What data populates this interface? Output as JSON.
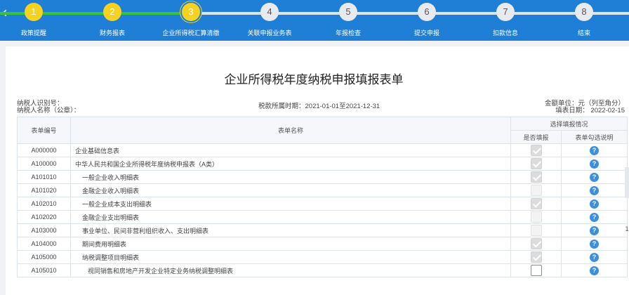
{
  "nav": {
    "back_glyph": "‹"
  },
  "steps": [
    {
      "num": "1",
      "label": "政策提醒",
      "state": "done"
    },
    {
      "num": "2",
      "label": "财务报表",
      "state": "done"
    },
    {
      "num": "3",
      "label": "企业所得税汇算清缴",
      "state": "current"
    },
    {
      "num": "4",
      "label": "关联申报业务表",
      "state": "todo"
    },
    {
      "num": "5",
      "label": "年报检查",
      "state": "todo"
    },
    {
      "num": "6",
      "label": "提交申报",
      "state": "todo"
    },
    {
      "num": "7",
      "label": "扣款信息",
      "state": "todo"
    },
    {
      "num": "8",
      "label": "结束",
      "state": "todo"
    }
  ],
  "page": {
    "title": "企业所得税年度纳税申报填报表单",
    "taxpayer_id_label": "纳税人识别号：",
    "taxpayer_name_label": "纳税人名称（公章）：",
    "tax_period": "税款所属时期：2021-01-01至2021-12-31",
    "amount_unit": "金额单位：元（列至角分）",
    "fill_date": "填表日期： 2022-02-15"
  },
  "side_number": "1",
  "table": {
    "headers": {
      "code": "表单编号",
      "name": "表单名称",
      "group": "选择填报情况",
      "fill": "是否填报",
      "explain": "表单勾选说明"
    },
    "rows": [
      {
        "code": "A000000",
        "name": "企业基础信息表",
        "level": 0,
        "check": "checked"
      },
      {
        "code": "A100000",
        "name": "中华人民共和国企业所得税年度纳税申报表（A类）",
        "level": 0,
        "check": "checked"
      },
      {
        "code": "A101010",
        "name": "一般企业收入明细表",
        "level": 1,
        "check": "checked"
      },
      {
        "code": "A101020",
        "name": "金融企业收入明细表",
        "level": 1,
        "check": "disabled"
      },
      {
        "code": "A102010",
        "name": "一般企业成本支出明细表",
        "level": 1,
        "check": "checked"
      },
      {
        "code": "A102020",
        "name": "金融企业支出明细表",
        "level": 1,
        "check": "disabled"
      },
      {
        "code": "A103000",
        "name": "事业单位、民间非营利组织收入、支出明细表",
        "level": 1,
        "check": "disabled"
      },
      {
        "code": "A104000",
        "name": "期间费用明细表",
        "level": 1,
        "check": "checked"
      },
      {
        "code": "A105000",
        "name": "纳税调整项目明细表",
        "level": 1,
        "check": "checked"
      },
      {
        "code": "A105010",
        "name": "视同销售和房地产开发企业特定业务纳税调整明细表",
        "level": 2,
        "check": "active"
      }
    ]
  },
  "help_glyph": "?"
}
